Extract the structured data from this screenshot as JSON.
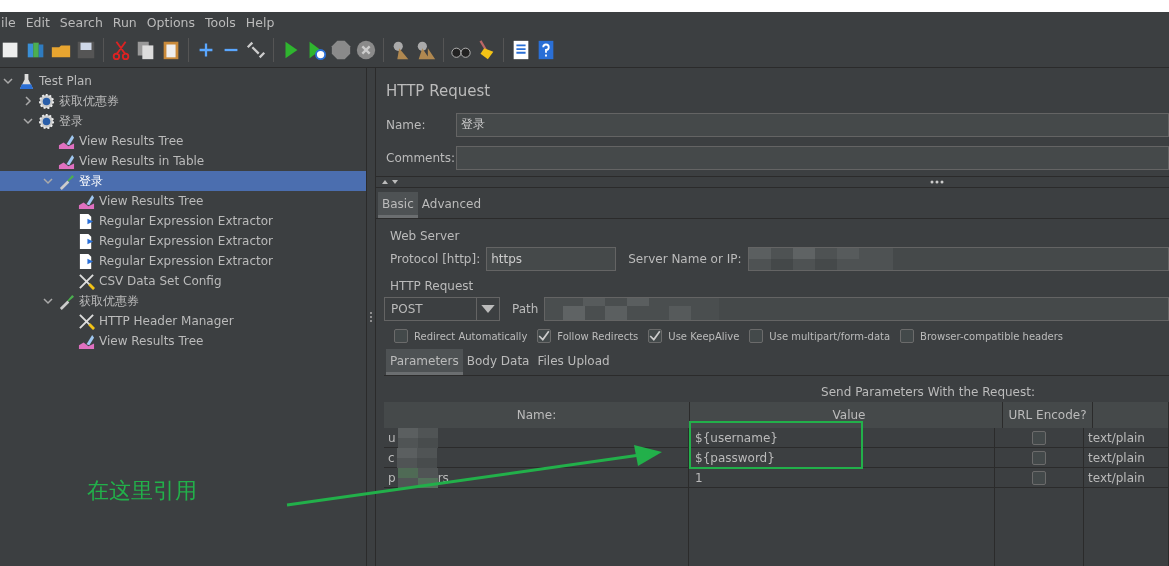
{
  "menu": [
    "ile",
    "Edit",
    "Search",
    "Run",
    "Options",
    "Tools",
    "Help"
  ],
  "tree": [
    {
      "label": "Test Plan",
      "kind": "plan",
      "expanded": true,
      "selected": false,
      "children": [
        {
          "label": "获取优惠券",
          "kind": "group",
          "expanded": false,
          "selected": false
        },
        {
          "label": "登录",
          "kind": "group",
          "expanded": true,
          "selected": false,
          "children": [
            {
              "label": "View Results Tree",
              "kind": "listener",
              "selected": false
            },
            {
              "label": "View Results in Table",
              "kind": "listener",
              "selected": false
            },
            {
              "label": "登录",
              "kind": "sampler",
              "expanded": true,
              "selected": true,
              "children": [
                {
                  "label": "View Results Tree",
                  "kind": "listener",
                  "selected": false
                },
                {
                  "label": "Regular Expression Extractor",
                  "kind": "extractor",
                  "selected": false
                },
                {
                  "label": "Regular Expression Extractor",
                  "kind": "extractor",
                  "selected": false
                },
                {
                  "label": "Regular Expression Extractor",
                  "kind": "extractor",
                  "selected": false
                },
                {
                  "label": "CSV Data Set Config",
                  "kind": "config",
                  "selected": false
                }
              ]
            },
            {
              "label": "获取优惠券",
              "kind": "sampler",
              "expanded": true,
              "selected": false,
              "children": [
                {
                  "label": "HTTP Header Manager",
                  "kind": "config",
                  "selected": false
                },
                {
                  "label": "View Results Tree",
                  "kind": "listener",
                  "selected": false
                }
              ]
            }
          ]
        }
      ]
    }
  ],
  "panel": {
    "title": "HTTP Request",
    "name_label": "Name:",
    "name_value": "登录",
    "comments_label": "Comments:"
  },
  "config_tabs": [
    {
      "label": "Basic",
      "selected": true
    },
    {
      "label": "Advanced",
      "selected": false
    }
  ],
  "web_server": {
    "legend": "Web Server",
    "protocol_label": "Protocol [http]:",
    "protocol_value": "https",
    "server_label": "Server Name or IP:"
  },
  "http_request": {
    "legend": "HTTP Request",
    "method": "POST",
    "path_label": "Path"
  },
  "options": [
    {
      "label": "Redirect Automatically",
      "checked": false
    },
    {
      "label": "Follow Redirects",
      "checked": true
    },
    {
      "label": "Use KeepAlive",
      "checked": true
    },
    {
      "label": "Use multipart/form-data",
      "checked": false
    },
    {
      "label": "Browser-compatible headers",
      "checked": false
    }
  ],
  "param_tabs": [
    {
      "label": "Parameters",
      "selected": true
    },
    {
      "label": "Body Data",
      "selected": false
    },
    {
      "label": "Files Upload",
      "selected": false
    }
  ],
  "params": {
    "caption": "Send Parameters With the Request:",
    "columns": [
      "Name:",
      "Value",
      "URL Encode?"
    ],
    "rows": [
      {
        "name": "u",
        "name_end": "",
        "value": "${username}",
        "url_encode": false,
        "content_type": "text/plain"
      },
      {
        "name": "c",
        "name_end": "",
        "value": "${password}",
        "url_encode": false,
        "content_type": "text/plain"
      },
      {
        "name": "p",
        "name_end": "rs",
        "value": "1",
        "url_encode": false,
        "content_type": "text/plain"
      }
    ]
  },
  "annotation": {
    "text": "在这里引用"
  }
}
